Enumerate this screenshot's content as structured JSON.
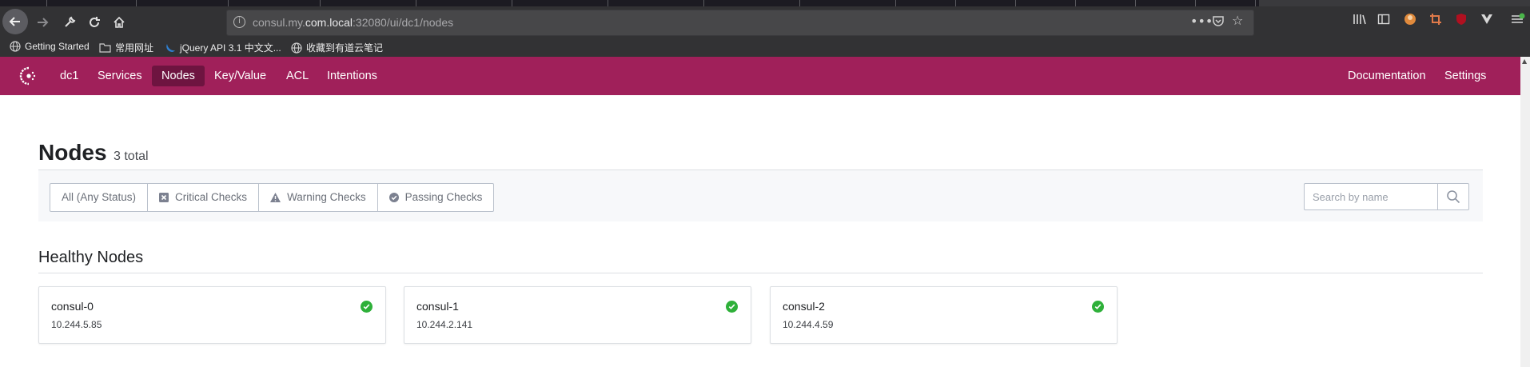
{
  "browser": {
    "url_prefix": "consul.my.",
    "url_host": "com.local",
    "url_rest": ":32080/ui/dc1/nodes",
    "bookmarks": [
      {
        "label": "Getting Started",
        "icon": "globe-icon"
      },
      {
        "label": "常用网址",
        "icon": "folder-icon"
      },
      {
        "label": "jQuery API 3.1 中文文...",
        "icon": "jquery-icon"
      },
      {
        "label": "收藏到有道云笔记",
        "icon": "globe-icon"
      }
    ]
  },
  "nav": {
    "datacenter": "dc1",
    "items": [
      {
        "label": "Services",
        "active": false
      },
      {
        "label": "Nodes",
        "active": true
      },
      {
        "label": "Key/Value",
        "active": false
      },
      {
        "label": "ACL",
        "active": false
      },
      {
        "label": "Intentions",
        "active": false
      }
    ],
    "right": [
      {
        "label": "Documentation"
      },
      {
        "label": "Settings"
      }
    ],
    "brand_color": "#a0205a",
    "active_color": "#6e1440"
  },
  "page": {
    "title": "Nodes",
    "count": "3 total"
  },
  "filters": [
    {
      "label": "All (Any Status)",
      "icon": ""
    },
    {
      "label": "Critical Checks",
      "icon": "critical-icon"
    },
    {
      "label": "Warning Checks",
      "icon": "warning-icon"
    },
    {
      "label": "Passing Checks",
      "icon": "passing-icon"
    }
  ],
  "search": {
    "placeholder": "Search by name"
  },
  "section": {
    "title": "Healthy Nodes"
  },
  "nodes": [
    {
      "name": "consul-0",
      "address": "10.244.5.85",
      "status": "passing"
    },
    {
      "name": "consul-1",
      "address": "10.244.2.141",
      "status": "passing"
    },
    {
      "name": "consul-2",
      "address": "10.244.4.59",
      "status": "passing"
    }
  ],
  "colors": {
    "passing": "#2eb039"
  }
}
